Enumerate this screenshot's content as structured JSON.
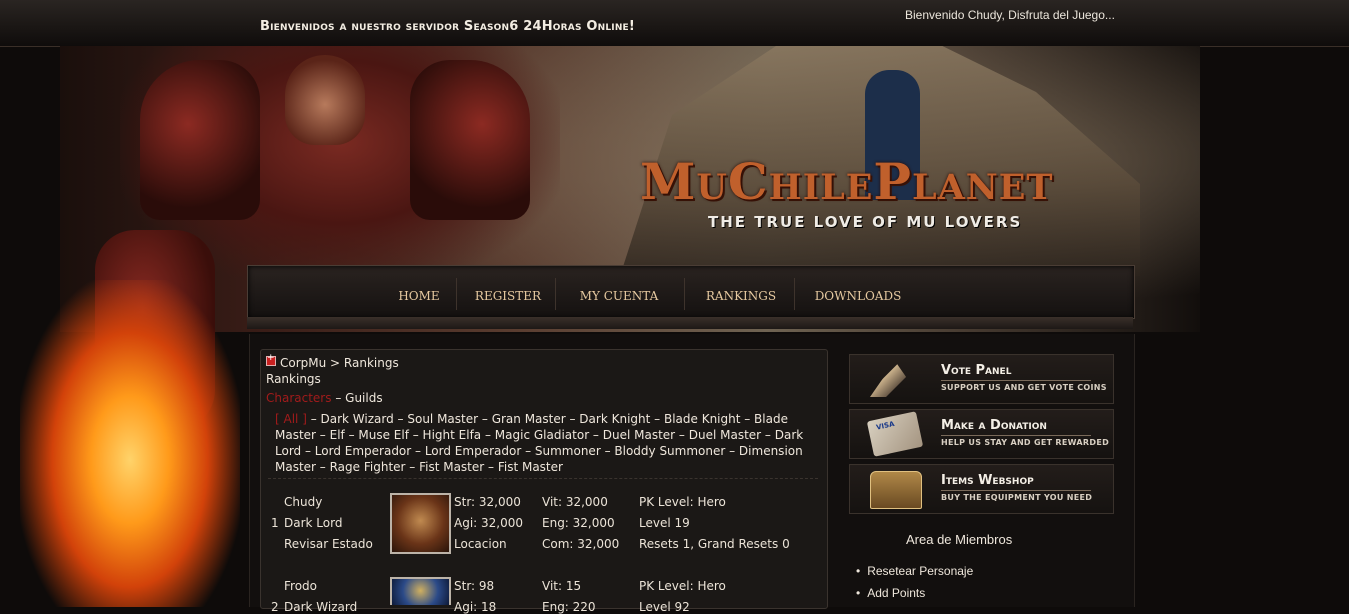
{
  "topbar": {
    "marquee": "Bienvenidos a nuestro servidor Season6 24Horas Online!",
    "greeting": "Bienvenido Chudy, Disfruta del Juego..."
  },
  "banner": {
    "title": "MuChilePlanet",
    "subtitle": "THE TRUE LOVE OF MU LOVERS"
  },
  "nav": {
    "items": [
      "HOME",
      "REGISTER",
      "MY CUENTA",
      "RANKINGS",
      "DOWNLOADS"
    ]
  },
  "breadcrumb": "CorpMu > Rankings",
  "section_title": "Rankings",
  "tabs": {
    "characters": "Characters",
    "separator": " – ",
    "guilds": "Guilds"
  },
  "class_filter": {
    "all": "[ All ]",
    "classes": "– Dark Wizard – Soul Master – Gran Master – Dark Knight – Blade Knight – Blade Master – Elf – Muse Elf – Hight Elfa – Magic Gladiator – Duel Master – Duel Master – Dark Lord – Lord Emperador – Lord Emperador – Summoner – Bloddy Summoner – Dimension Master – Rage Fighter – Fist Master – Fist Master"
  },
  "rankings": [
    {
      "rank": "1",
      "name": "Chudy",
      "class": "Dark Lord",
      "status_link": "Revisar Estado",
      "str": "Str: 32,000",
      "agi": "Agi: 32,000",
      "location": "Locacion",
      "vit": "Vit: 32,000",
      "eng": "Eng: 32,000",
      "com": "Com: 32,000",
      "pk": "PK Level: Hero",
      "level": "Level 19",
      "resets": "Resets 1, Grand Resets 0"
    },
    {
      "rank": "2",
      "name": "Frodo",
      "class": "Dark Wizard",
      "str": "Str: 98",
      "agi": "Agi: 18",
      "vit": "Vit: 15",
      "eng": "Eng: 220",
      "pk": "PK Level: Hero",
      "level": "Level 92"
    }
  ],
  "sidebar": {
    "vote": {
      "title": "Vote Panel",
      "sub": "SUPPORT US AND GET VOTE COINS"
    },
    "donation": {
      "title": "Make a Donation",
      "sub": "HELP US STAY AND GET REWARDED"
    },
    "webshop": {
      "title": "Items Webshop",
      "sub": "BUY THE EQUIPMENT YOU NEED"
    },
    "members_title": "Area de Miembros",
    "member_links": [
      "Resetear Personaje",
      "Add Points"
    ]
  }
}
